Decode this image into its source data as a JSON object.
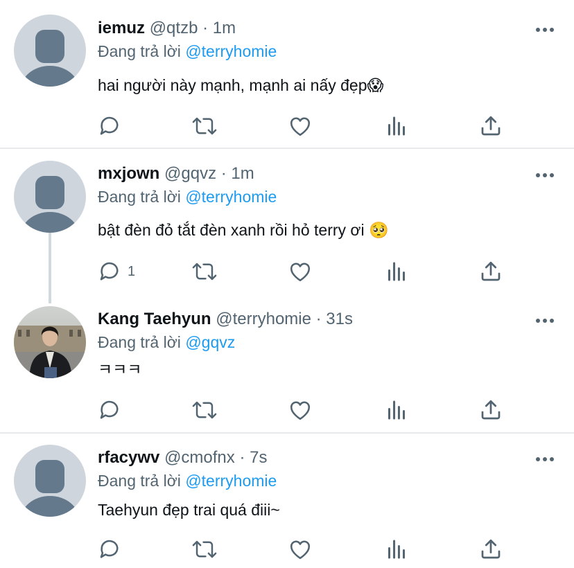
{
  "reply_prefix": "Đang trả lời",
  "tweets": [
    {
      "name": "iemuz",
      "meta": "@qtzb · 1m",
      "reply_to": "@terryhomie",
      "text": "hai người này mạnh, mạnh ai nấy đẹp",
      "emoji": "😱",
      "reply_count": ""
    },
    {
      "name": "mxjown",
      "meta": "@gqvz · 1m",
      "reply_to": "@terryhomie",
      "text": "bật đèn đỏ tắt đèn xanh rồi hỏ terry ơi",
      "emoji": "🥺",
      "reply_count": "1"
    },
    {
      "name": "Kang Taehyun",
      "meta": "@terryhomie · 31s",
      "reply_to": "@gqvz",
      "text": "ㅋㅋㅋ",
      "emoji": "",
      "reply_count": ""
    },
    {
      "name": "rfacywv",
      "meta": "@cmofnx · 7s",
      "reply_to": "@terryhomie",
      "text": "Taehyun đẹp trai quá điii~",
      "emoji": "",
      "reply_count": ""
    }
  ],
  "icons": {
    "reply": "reply-icon",
    "retweet": "retweet-icon",
    "like": "heart-icon",
    "views": "analytics-icon",
    "share": "share-icon",
    "more": "more-icon"
  },
  "colors": {
    "mention": "#1d9bf0",
    "secondary": "#536471",
    "default_avatar": "#ced5dc",
    "default_avatar_figure": "#64798b"
  }
}
